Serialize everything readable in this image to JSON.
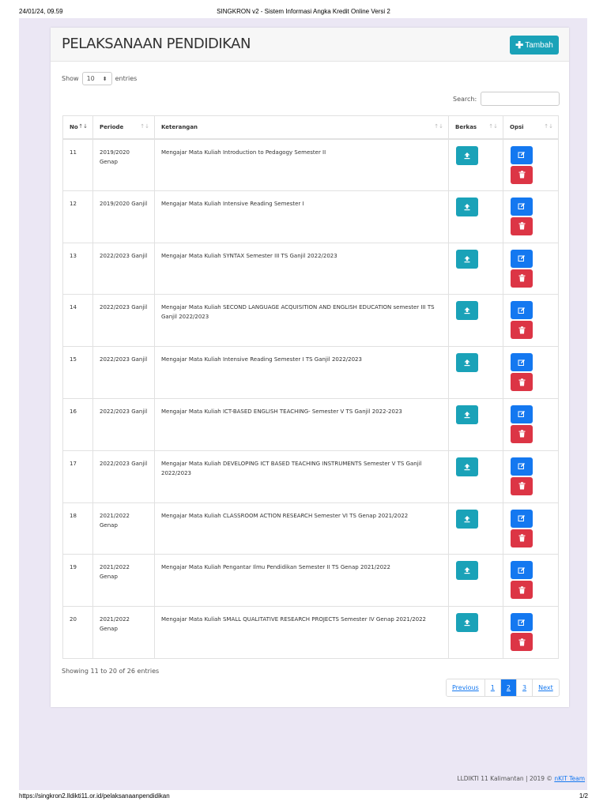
{
  "print": {
    "date": "24/01/24, 09.59",
    "title": "SINGKRON v2 - Sistem Informasi Angka Kredit Online Versi 2",
    "url": "https://singkron2.lldikti11.or.id/pelaksanaanpendidikan",
    "page_number": "1/2"
  },
  "header": {
    "title": "PELAKSANAAN PENDIDIKAN",
    "add_label": "Tambah"
  },
  "controls": {
    "show_label": "Show",
    "entries_value": "10",
    "entries_label": "entries",
    "search_label": "Search:"
  },
  "table": {
    "columns": [
      "No",
      "Periode",
      "Keterangan",
      "Berkas",
      "Opsi"
    ],
    "rows": [
      {
        "no": "11",
        "periode": "2019/2020 Genap",
        "keterangan": "Mengajar Mata Kuliah Introduction to Pedagogy Semester II"
      },
      {
        "no": "12",
        "periode": "2019/2020 Ganjil",
        "keterangan": "Mengajar Mata Kuliah Intensive Reading Semester I"
      },
      {
        "no": "13",
        "periode": "2022/2023 Ganjil",
        "keterangan": "Mengajar Mata Kuliah SYNTAX Semester III TS Ganjil 2022/2023"
      },
      {
        "no": "14",
        "periode": "2022/2023 Ganjil",
        "keterangan": "Mengajar Mata Kuliah SECOND LANGUAGE ACQUISITION AND ENGLISH EDUCATION semester III TS Ganjil 2022/2023"
      },
      {
        "no": "15",
        "periode": "2022/2023 Ganjil",
        "keterangan": "Mengajar Mata Kuliah Intensive Reading Semester I TS Ganjil 2022/2023"
      },
      {
        "no": "16",
        "periode": "2022/2023 Ganjil",
        "keterangan": "Mengajar Mata Kuliah ICT-BASED ENGLISH TEACHING- Semester V TS Ganjil 2022-2023"
      },
      {
        "no": "17",
        "periode": "2022/2023 Ganjil",
        "keterangan": "Mengajar Mata Kuliah DEVELOPING ICT BASED TEACHING INSTRUMENTS Semester V TS Ganjil 2022/2023"
      },
      {
        "no": "18",
        "periode": "2021/2022 Genap",
        "keterangan": "Mengajar Mata Kuliah CLASSROOM ACTION RESEARCH Semester VI TS Genap 2021/2022"
      },
      {
        "no": "19",
        "periode": "2021/2022 Genap",
        "keterangan": "Mengajar Mata Kuliah Pengantar Ilmu Pendidikan Semester II TS Genap 2021/2022"
      },
      {
        "no": "20",
        "periode": "2021/2022 Genap",
        "keterangan": "Mengajar Mata Kuliah SMALL QUALITATIVE RESEARCH PROJECTS Semester IV Genap 2021/2022"
      }
    ]
  },
  "footer": {
    "info": "Showing 11 to 20 of 26 entries",
    "pagination": [
      "Previous",
      "1",
      "2",
      "3",
      "Next"
    ],
    "active_page": "2",
    "credit_text": "LLDIKTI 11 Kalimantan | 2019 ©",
    "credit_link": "nKIT Team"
  },
  "colors": {
    "accent": "#1aa2b8",
    "primary": "#1478f0",
    "danger": "#dc3545",
    "background": "#ebe7f4"
  },
  "icons": {
    "sort": "sort-arrows-icon",
    "upload": "upload-icon",
    "edit": "edit-icon",
    "delete": "trash-icon",
    "add": "plus-icon",
    "select": "updown-caret-icon"
  }
}
